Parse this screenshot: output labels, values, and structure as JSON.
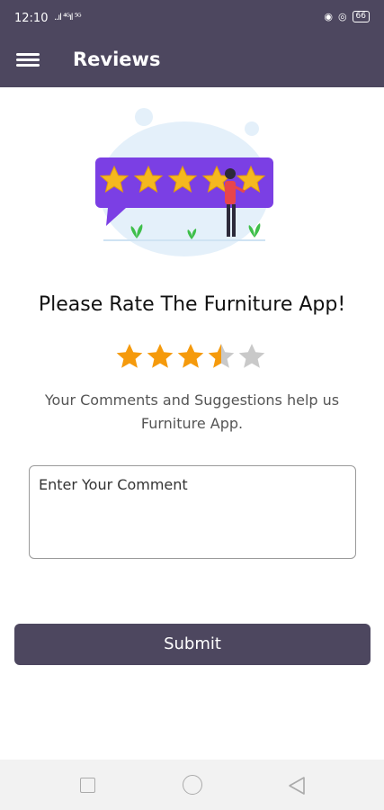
{
  "status_bar": {
    "time": "12:10",
    "signal_text": "..ıl ⁴ᴳıl ⁵ᴳ",
    "battery": "66"
  },
  "app_bar": {
    "title": "Reviews"
  },
  "main": {
    "heading": "Please Rate The Furniture App!",
    "rating": {
      "value": 3.5,
      "max": 5
    },
    "description": "Your Comments and Suggestions help us Furniture App.",
    "comment_placeholder": "Enter Your Comment",
    "submit_label": "Submit"
  },
  "colors": {
    "primary": "#4d475f",
    "star_filled": "#f59a0c",
    "star_empty": "#c9c9c9",
    "illustration_bubble": "#7b3fe4"
  },
  "icons": {
    "menu": "hamburger-menu-icon",
    "nav_recent": "square-icon",
    "nav_home": "circle-icon",
    "nav_back": "triangle-back-icon"
  }
}
